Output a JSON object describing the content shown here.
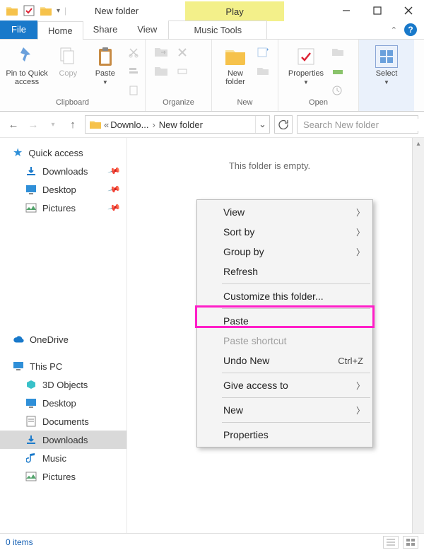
{
  "titlebar": {
    "title": "New folder",
    "context_tab_header": "Play"
  },
  "tabs": {
    "file": "File",
    "home": "Home",
    "share": "Share",
    "view": "View",
    "music_tools": "Music Tools"
  },
  "ribbon": {
    "pin": "Pin to Quick\naccess",
    "copy": "Copy",
    "paste": "Paste",
    "clipboard_label": "Clipboard",
    "organize_label": "Organize",
    "new_folder": "New\nfolder",
    "new_label": "New",
    "properties": "Properties",
    "open_label": "Open",
    "select": "Select",
    "select_label": ""
  },
  "address": {
    "seg1": "Downlo...",
    "seg2": "New folder",
    "search_placeholder": "Search New folder"
  },
  "nav": {
    "quick_access": "Quick access",
    "downloads": "Downloads",
    "desktop": "Desktop",
    "pictures": "Pictures",
    "onedrive": "OneDrive",
    "this_pc": "This PC",
    "objects_3d": "3D Objects",
    "desktop2": "Desktop",
    "documents": "Documents",
    "downloads2": "Downloads",
    "music": "Music",
    "pictures2": "Pictures"
  },
  "content": {
    "empty": "This folder is empty."
  },
  "context_menu": {
    "view": "View",
    "sort_by": "Sort by",
    "group_by": "Group by",
    "refresh": "Refresh",
    "customize": "Customize this folder...",
    "paste": "Paste",
    "paste_shortcut": "Paste shortcut",
    "undo_new": "Undo New",
    "undo_shortcut": "Ctrl+Z",
    "give_access": "Give access to",
    "new": "New",
    "properties": "Properties"
  },
  "status": {
    "items": "0 items"
  }
}
